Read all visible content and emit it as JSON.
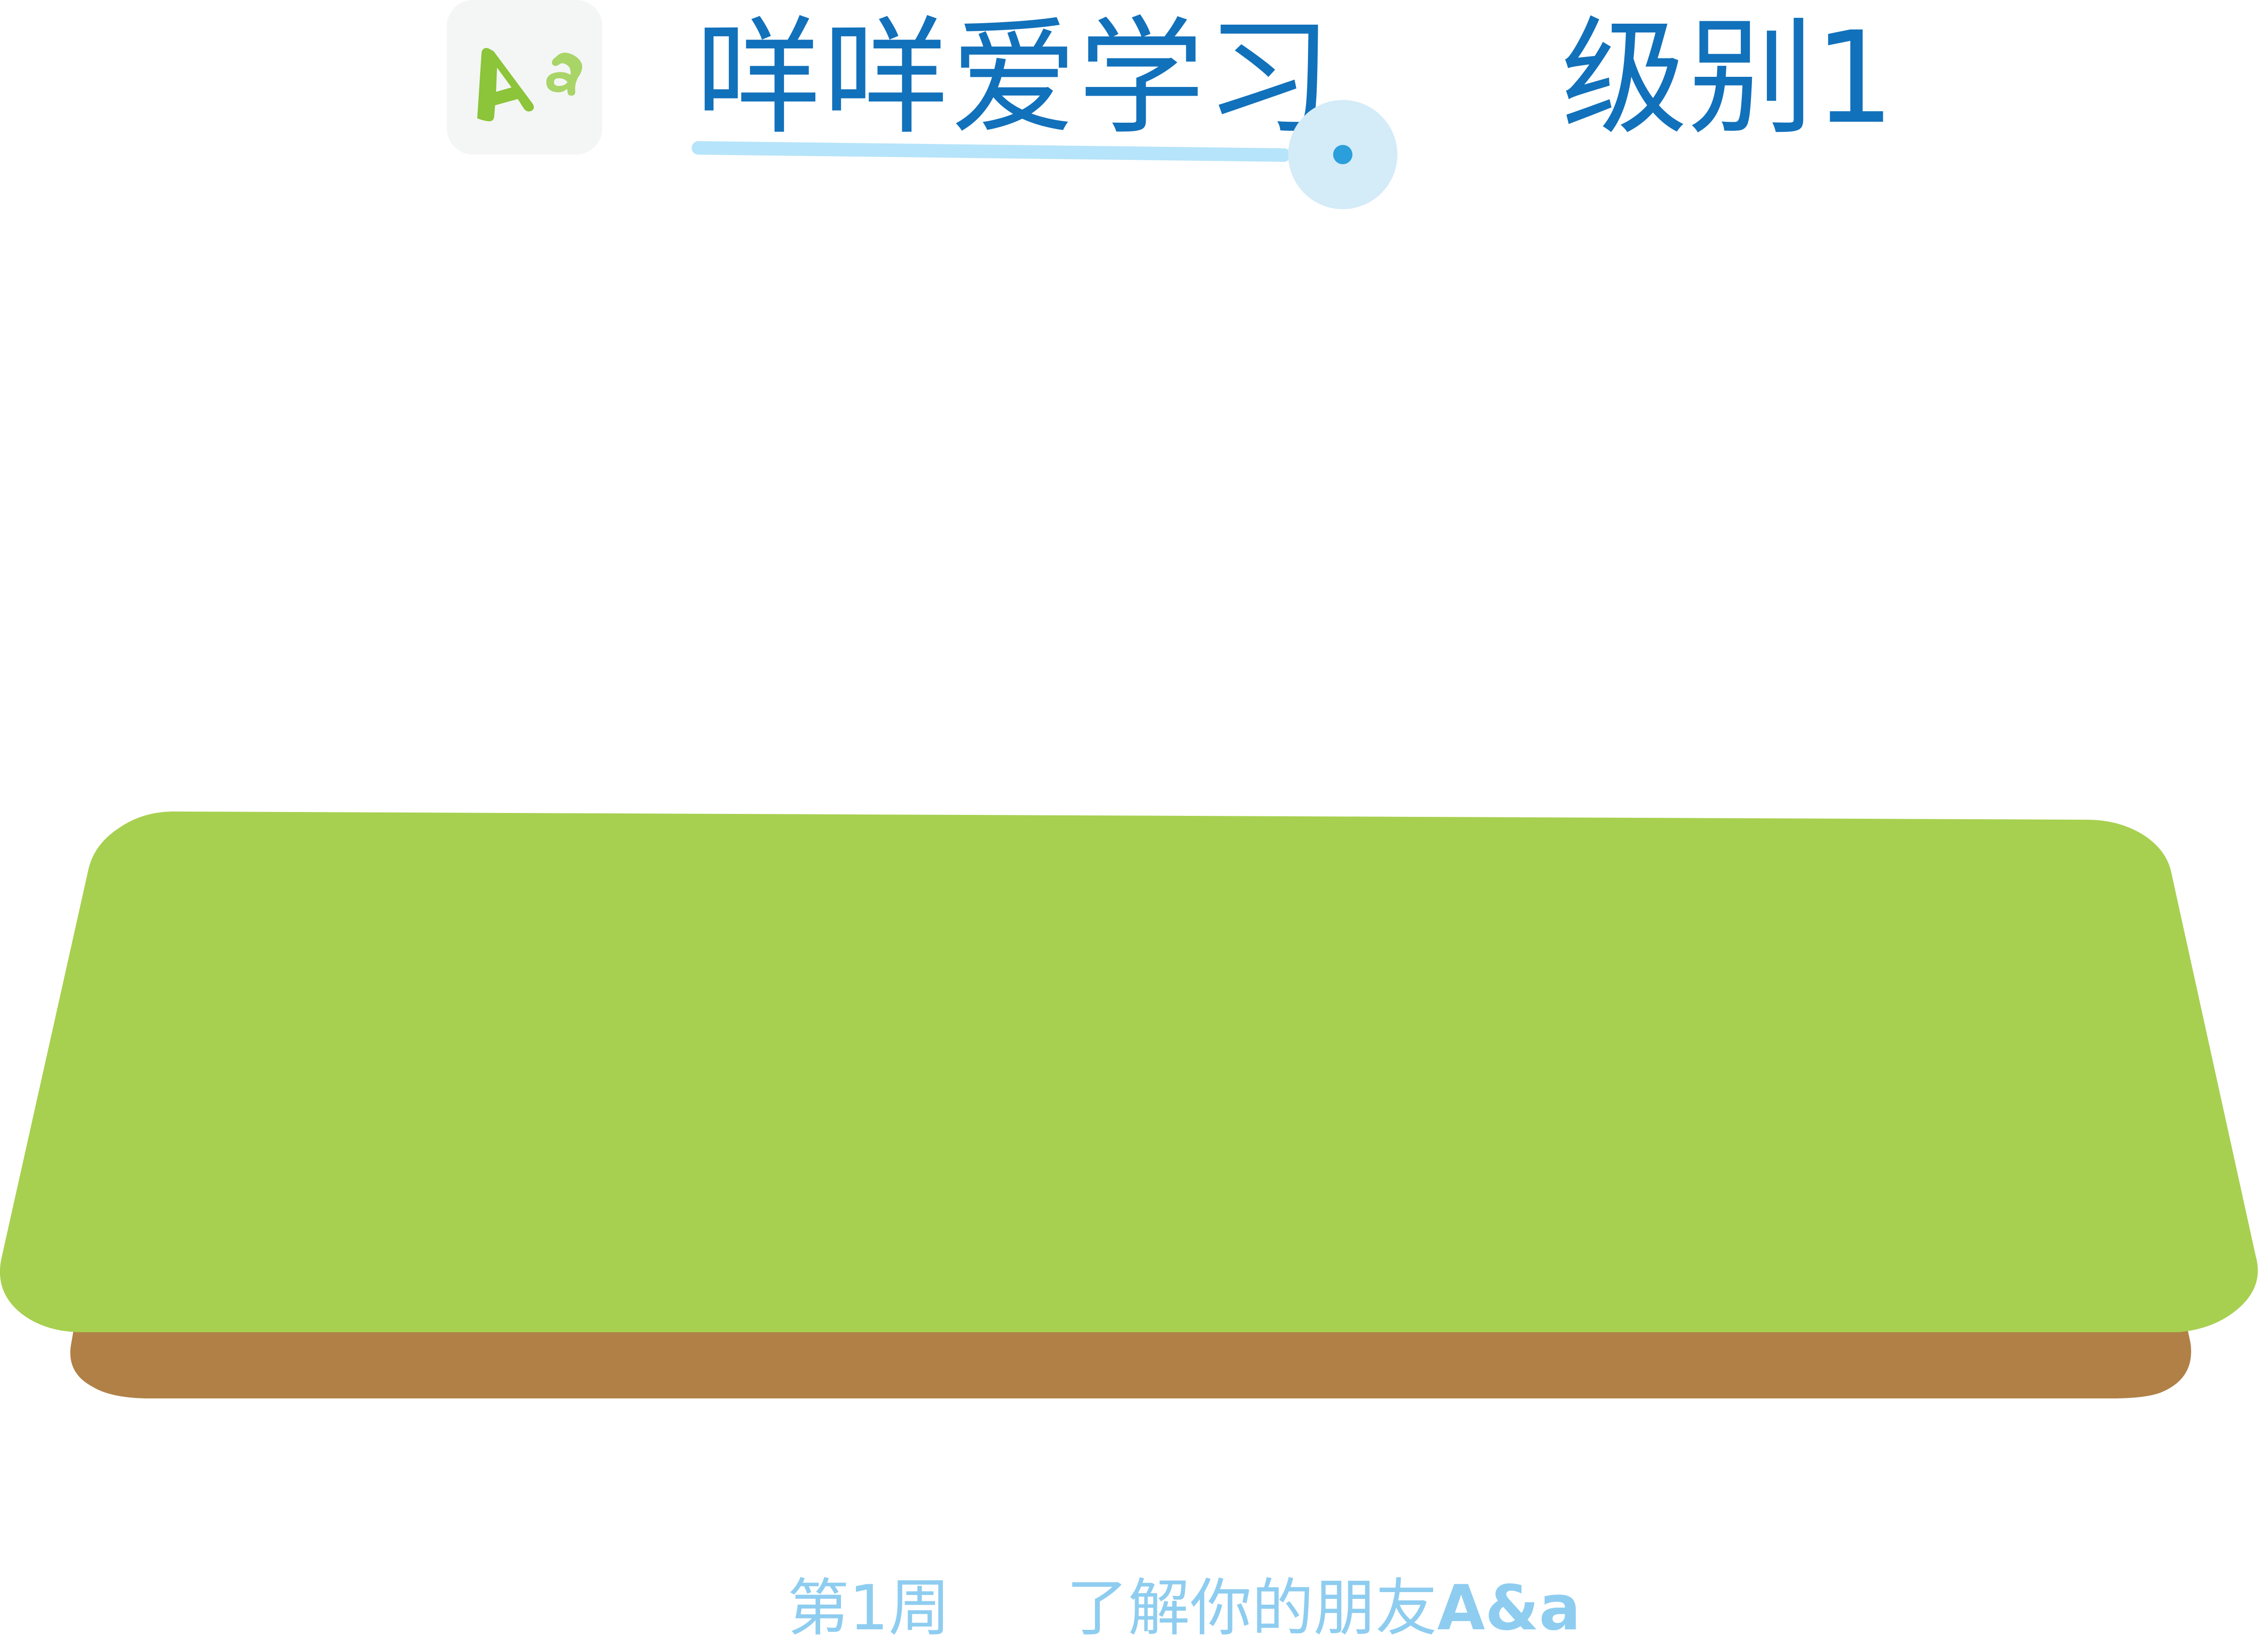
{
  "header": {
    "app_icon": {
      "icon": "letters-a-icon",
      "label_upper": "A",
      "label_lower": "a"
    },
    "title": "咩咩爱学习",
    "level_label": "级别1"
  },
  "progress": {
    "value": 0.0
  },
  "scene": {
    "ground_top_color": "#a7d050",
    "ground_side_color": "#b08046"
  },
  "footer": {
    "week_label": "第1周",
    "topic_text": "了解你的朋友",
    "topic_letters": "A&a"
  },
  "colors": {
    "title": "#1271bb",
    "footer": "#8ecdf0",
    "progress_track": "#b6e4fa",
    "progress_dot": "#2b9fdb",
    "icon_bg": "#f4f6f5",
    "icon_green_dark": "#8cc43a",
    "icon_green_light": "#a9d468"
  }
}
